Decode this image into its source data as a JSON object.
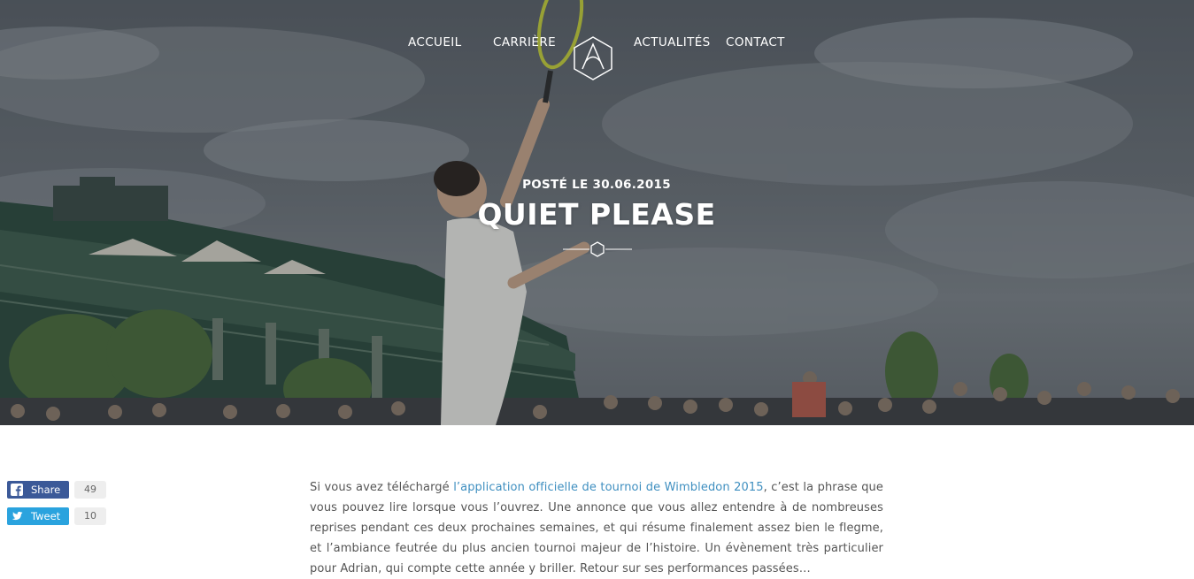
{
  "nav": {
    "items": [
      {
        "label": "ACCUEIL"
      },
      {
        "label": "CARRIÈRE"
      },
      {
        "label": "ACTUALITÉS"
      },
      {
        "label": "CONTACT"
      }
    ],
    "logo_letter": "A"
  },
  "post": {
    "date_label": "POSTÉ LE 30.06.2015",
    "title": "QUIET PLEASE"
  },
  "social": {
    "share": {
      "label": "Share",
      "count": "49",
      "color": "#3b5998"
    },
    "tweet": {
      "label": "Tweet",
      "count": "10",
      "color": "#2aa3de"
    }
  },
  "article": {
    "text_before_link": "Si vous avez téléchargé ",
    "link_text": "l’application officielle de tournoi de Wimbledon 2015",
    "text_after_link": ", c’est la phrase que vous pouvez lire lorsque vous l’ouvrez. Une annonce que vous allez entendre à de nombreuses reprises pendant ces deux prochaines semaines, et qui résume finalement assez bien le flegme, et l’ambiance feutrée du plus ancien tournoi majeur de l’histoire. Un évènement très particulier pour Adrian, qui compte cette année y briller. Retour sur ses performances passées…",
    "link_color": "#3f8fc0"
  },
  "hero": {
    "image": "tennis-player-serving-wimbledon"
  }
}
